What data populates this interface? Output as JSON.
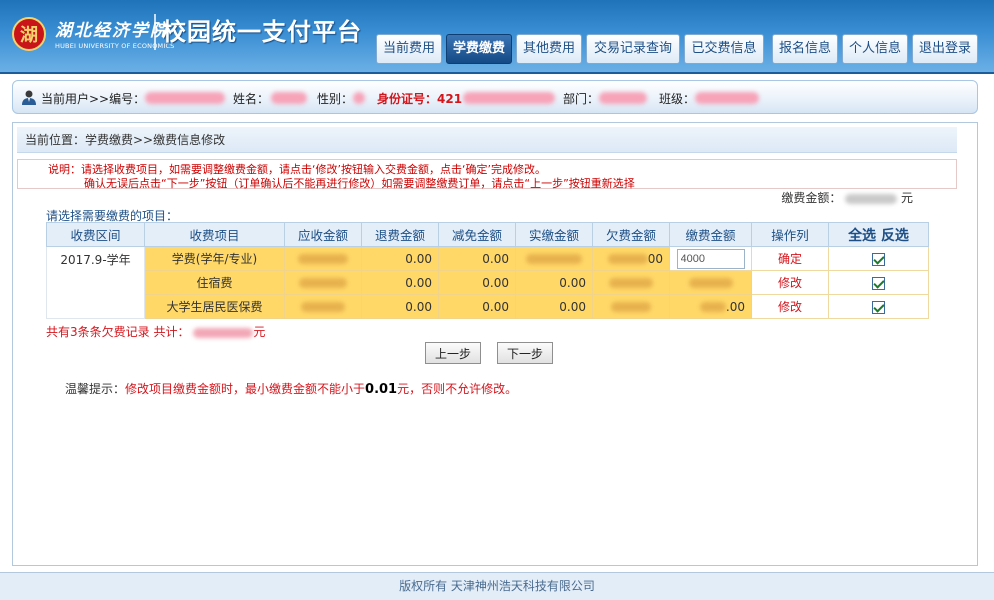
{
  "header": {
    "logo_char": "湖",
    "school_name_cn": "湖北经济学院",
    "school_name_en": "HUBEI UNIVERSITY OF ECONOMICS",
    "platform_title": "校园统一支付平台"
  },
  "nav": {
    "tabs": [
      {
        "label": "当前费用",
        "active": false
      },
      {
        "label": "学费缴费",
        "active": true
      },
      {
        "label": "其他费用",
        "active": false
      },
      {
        "label": "交易记录查询",
        "active": false
      },
      {
        "label": "已交费信息",
        "active": false
      },
      {
        "label": "报名信息",
        "active": false
      },
      {
        "label": "个人信息",
        "active": false
      },
      {
        "label": "退出登录",
        "active": false
      }
    ]
  },
  "userbar": {
    "current_user_label": "当前用户>>编号：",
    "name_label": "姓名：",
    "gender_label": "性别：",
    "id_label": "身份证号：421",
    "dept_label": "部门：",
    "class_label": "班级："
  },
  "breadcrumb": "当前位置：学费缴费>>缴费信息修改",
  "notice": {
    "line1": "说明：请选择收费项目，如需要调整缴费金额，请点击‘修改’按钮输入交费金额，点击‘确定’完成修改。",
    "line2": "确认无误后点击“下一步”按钮（订单确认后不能再进行修改）如需要调整缴费订单，请点击“上一步”按钮重新选择"
  },
  "pay_amount": {
    "label": "缴费金额：",
    "unit": "元"
  },
  "select_title": "请选择需要缴费的项目：",
  "table": {
    "headers": [
      "收费区间",
      "收费项目",
      "应收金额",
      "退费金额",
      "减免金额",
      "实缴金额",
      "欠费金额",
      "缴费金额",
      "操作列"
    ],
    "select_all": "全选",
    "invert": "反选",
    "period": "2017.9-学年",
    "rows": [
      {
        "item": "学费(学年/专业)",
        "refund": "0.00",
        "waive": "0.00",
        "paid_visible": "",
        "owed_suffix": "00",
        "op": "确定",
        "input_value": "4000"
      },
      {
        "item": "住宿费",
        "refund": "0.00",
        "waive": "0.00",
        "paid_visible": "0.00",
        "owed_suffix": "",
        "op": "修改",
        "input_value": ""
      },
      {
        "item": "大学生居民医保费",
        "refund": "0.00",
        "waive": "0.00",
        "paid_visible": "0.00",
        "owed_suffix": "",
        "op": "修改",
        "input_value": ".00"
      }
    ]
  },
  "summary": {
    "records": "共有3条条欠费记录",
    "total_label": "共计：",
    "total_suffix": "元"
  },
  "buttons": {
    "prev": "上一步",
    "next": "下一步"
  },
  "tip": {
    "prefix": "温馨提示：",
    "text": "修改项目缴费金额时，最小缴费金额不能小于",
    "amount": "0.01",
    "suffix": "元，否则不允许修改。"
  },
  "footer": "版权所有 天津神州浩天科技有限公司"
}
